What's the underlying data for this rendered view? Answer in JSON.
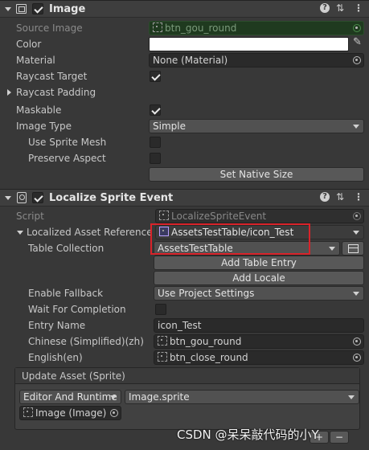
{
  "image_component": {
    "title": "Image",
    "source_image_label": "Source Image",
    "source_image_value": "btn_gou_round",
    "color_label": "Color",
    "material_label": "Material",
    "material_value": "None (Material)",
    "raycast_target_label": "Raycast Target",
    "raycast_padding_label": "Raycast Padding",
    "maskable_label": "Maskable",
    "image_type_label": "Image Type",
    "image_type_value": "Simple",
    "use_sprite_mesh_label": "Use Sprite Mesh",
    "preserve_aspect_label": "Preserve Aspect",
    "set_native_size_label": "Set Native Size"
  },
  "localize_component": {
    "title": "Localize Sprite Event",
    "script_label": "Script",
    "script_value": "LocalizeSpriteEvent",
    "localized_asset_reference_label": "Localized Asset Reference",
    "localized_asset_reference_value": "AssetsTestTable/icon_Test",
    "table_collection_label": "Table Collection",
    "table_collection_value": "AssetsTestTable",
    "add_table_entry_label": "Add Table Entry",
    "add_locale_label": "Add Locale",
    "enable_fallback_label": "Enable Fallback",
    "enable_fallback_value": "Use Project Settings",
    "wait_for_completion_label": "Wait For Completion",
    "entry_name_label": "Entry Name",
    "entry_name_value": "icon_Test",
    "locales": [
      {
        "label": "Chinese (Simplified)(zh)",
        "value": "btn_gou_round"
      },
      {
        "label": "English(en)",
        "value": "btn_close_round"
      }
    ],
    "update_asset_title": "Update Asset (Sprite)",
    "runtime_mode_value": "Editor And Runtime",
    "function_value": "Image.sprite",
    "target_object_value": "Image (Image)"
  },
  "watermark": "CSDN @呆呆敲代码的小Y",
  "colors": {
    "highlight_box": "#d9232a",
    "background": "#383838",
    "color_swatch": "#ffffff"
  }
}
